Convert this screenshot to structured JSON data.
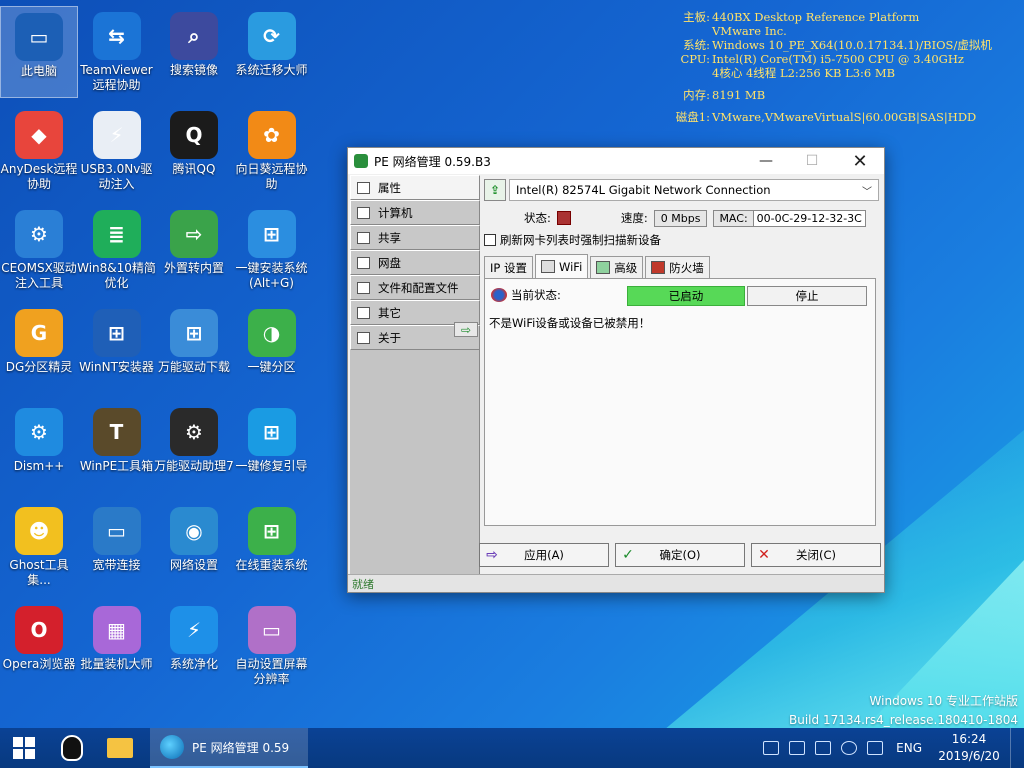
{
  "desktop": {
    "icons": [
      {
        "label": "此电脑",
        "color": "#1c5fb5",
        "glyph": "▭"
      },
      {
        "label": "TeamViewer远程协助",
        "color": "#1b74d6",
        "glyph": "⇆"
      },
      {
        "label": "搜索镜像",
        "color": "#3d4a9e",
        "glyph": "⌕"
      },
      {
        "label": "系统迁移大师",
        "color": "#2a9be0",
        "glyph": "⟳"
      },
      {
        "label": "AnyDesk远程协助",
        "color": "#e8453c",
        "glyph": "◆"
      },
      {
        "label": "USB3.0Nv驱动注入",
        "color": "#e9eef5",
        "glyph": "⚡"
      },
      {
        "label": "腾讯QQ",
        "color": "#1b1b1b",
        "glyph": "Q"
      },
      {
        "label": "向日葵远程协助",
        "color": "#f28a16",
        "glyph": "✿"
      },
      {
        "label": "CEOMSX驱动注入工具",
        "color": "#2a7fd6",
        "glyph": "⚙"
      },
      {
        "label": "Win8&10精简优化",
        "color": "#1fae5a",
        "glyph": "≣"
      },
      {
        "label": "外置转内置",
        "color": "#3aa34a",
        "glyph": "⇨"
      },
      {
        "label": "一键安装系统(Alt+G)",
        "color": "#2b8ee0",
        "glyph": "⊞"
      },
      {
        "label": "DG分区精灵",
        "color": "#f0a11f",
        "glyph": "G"
      },
      {
        "label": "WinNT安装器",
        "color": "#1f5fb7",
        "glyph": "⊞"
      },
      {
        "label": "万能驱动下载",
        "color": "#3a8cd8",
        "glyph": "⊞"
      },
      {
        "label": "一键分区",
        "color": "#3cb04a",
        "glyph": "◑"
      },
      {
        "label": "Dism++",
        "color": "#1f8be0",
        "glyph": "⚙"
      },
      {
        "label": "WinPE工具箱",
        "color": "#5a4a2a",
        "glyph": "T"
      },
      {
        "label": "万能驱动助理7",
        "color": "#2a2a2a",
        "glyph": "⚙"
      },
      {
        "label": "一键修复引导",
        "color": "#1a9be3",
        "glyph": "⊞"
      },
      {
        "label": "Ghost工具集...",
        "color": "#f2c01f",
        "glyph": "☻"
      },
      {
        "label": "宽带连接",
        "color": "#2a7ac8",
        "glyph": "▭"
      },
      {
        "label": "网络设置",
        "color": "#2a8ad0",
        "glyph": "◉"
      },
      {
        "label": "在线重装系统",
        "color": "#3cb04a",
        "glyph": "⊞"
      },
      {
        "label": "Opera浏览器",
        "color": "#d4202c",
        "glyph": "O"
      },
      {
        "label": "批量装机大师",
        "color": "#a868d8",
        "glyph": "▦"
      },
      {
        "label": "系统净化",
        "color": "#1e90e8",
        "glyph": "⚡"
      },
      {
        "label": "自动设置屏幕分辨率",
        "color": "#b070c8",
        "glyph": "▭"
      }
    ]
  },
  "sysinfo": {
    "mb_key": "主板:",
    "mb_val": "440BX Desktop Reference Platform",
    "mb_vendor": "VMware Inc.",
    "sys_key": "系统:",
    "sys_val": "Windows 10_PE_X64(10.0.17134.1)/BIOS/虚拟机",
    "cpu_key": "CPU:",
    "cpu_val": "Intel(R) Core(TM) i5-7500 CPU @ 3.40GHz",
    "cpu_cores": "4核心   4线程  L2:256 KB L3:6 MB",
    "mem_key": "内存:",
    "mem_val": "8191 MB",
    "disk_key": "磁盘1:",
    "disk_val": "VMware,VMwareVirtualS|60.00GB|SAS|HDD"
  },
  "window": {
    "title": "PE 网络管理 0.59.B3",
    "min": "—",
    "max": "☐",
    "close": "✕",
    "sidebar": [
      {
        "label": "属性",
        "active": true
      },
      {
        "label": "计算机",
        "active": false
      },
      {
        "label": "共享",
        "active": false
      },
      {
        "label": "网盘",
        "active": false
      },
      {
        "label": "文件和配置文件",
        "active": false
      },
      {
        "label": "其它",
        "active": false
      },
      {
        "label": "关于",
        "active": false
      }
    ],
    "side_arrow": "⇨",
    "nic_name": "Intel(R) 82574L Gigabit Network Connection",
    "status_label": "状态:",
    "speed_label": "速度:",
    "speed_value": "0 Mbps",
    "mac_label": "MAC:",
    "mac_value": "00-0C-29-12-32-3C",
    "refresh_check": "刷新网卡列表时强制扫描新设备",
    "tabs": [
      {
        "label": "IP 设置",
        "icon": ""
      },
      {
        "label": "WiFi",
        "icon": "grey",
        "active": true
      },
      {
        "label": "高级",
        "icon": "grn"
      },
      {
        "label": "防火墙",
        "icon": "red"
      }
    ],
    "current_state_label": "当前状态:",
    "started_label": "已启动",
    "stop_label": "停止",
    "wifi_message": "不是WiFi设备或设备已被禁用！",
    "buttons": {
      "apply": "应用(A)",
      "ok": "确定(O)",
      "close": "关闭(C)"
    },
    "status_bar": "就绪"
  },
  "watermark": {
    "line1": "Windows 10 专业工作站版",
    "line2": "Build 17134.rs4_release.180410-1804"
  },
  "taskbar": {
    "active_app": "PE 网络管理 0.59",
    "lang": "ENG",
    "time": "16:24",
    "date": "2019/6/20"
  }
}
